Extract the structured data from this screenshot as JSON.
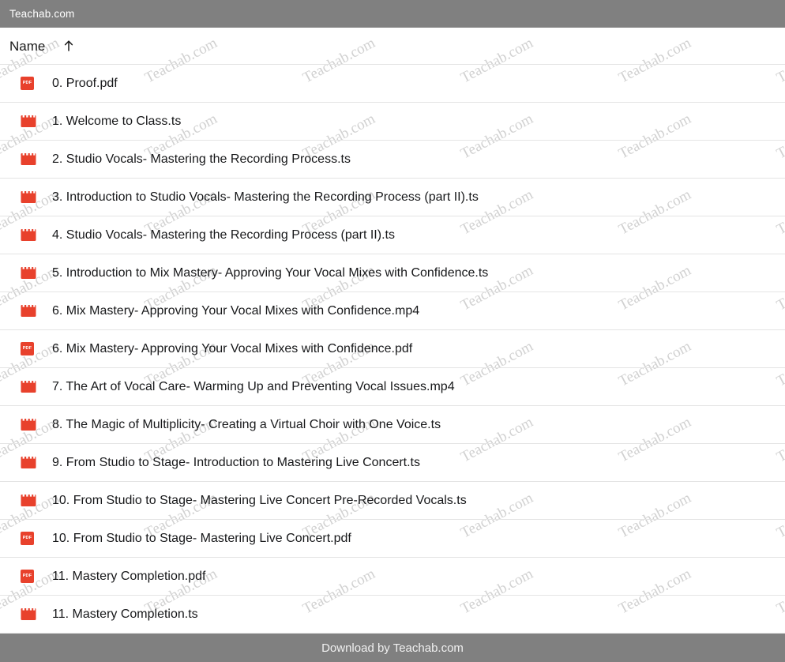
{
  "topbar": {
    "title": "Teachab.com"
  },
  "watermark": {
    "text": "Teachab.com",
    "color": "#c9c9c9"
  },
  "column_header": {
    "name_label": "Name",
    "sort_icon": "sort-ascending-arrow-icon",
    "sort_direction": "ascending"
  },
  "colors": {
    "bar_background": "#808080",
    "bar_text": "#ffffff",
    "row_text": "#17181a",
    "row_divider": "#e4e4e4",
    "pdf_icon": "#e8412c",
    "video_icon": "#e8412c"
  },
  "files": [
    {
      "icon": "pdf-file-icon",
      "type": "pdf",
      "name": "0. Proof.pdf"
    },
    {
      "icon": "video-file-icon",
      "type": "video",
      "name": "1. Welcome to Class.ts"
    },
    {
      "icon": "video-file-icon",
      "type": "video",
      "name": "2. Studio Vocals- Mastering the Recording Process.ts"
    },
    {
      "icon": "video-file-icon",
      "type": "video",
      "name": "3. Introduction to Studio Vocals- Mastering the Recording Process (part II).ts"
    },
    {
      "icon": "video-file-icon",
      "type": "video",
      "name": "4. Studio Vocals- Mastering the Recording Process (part II).ts"
    },
    {
      "icon": "video-file-icon",
      "type": "video",
      "name": "5. Introduction to Mix Mastery- Approving Your Vocal Mixes with Confidence.ts"
    },
    {
      "icon": "video-file-icon",
      "type": "video",
      "name": "6. Mix Mastery- Approving Your Vocal Mixes with Confidence.mp4"
    },
    {
      "icon": "pdf-file-icon",
      "type": "pdf",
      "name": "6. Mix Mastery- Approving Your Vocal Mixes with Confidence.pdf"
    },
    {
      "icon": "video-file-icon",
      "type": "video",
      "name": "7. The Art of Vocal Care- Warming Up and Preventing Vocal Issues.mp4"
    },
    {
      "icon": "video-file-icon",
      "type": "video",
      "name": "8. The Magic of Multiplicity- Creating a Virtual Choir with One Voice.ts"
    },
    {
      "icon": "video-file-icon",
      "type": "video",
      "name": "9. From Studio to Stage- Introduction to Mastering Live Concert.ts"
    },
    {
      "icon": "video-file-icon",
      "type": "video",
      "name": "10. From Studio to Stage- Mastering Live Concert Pre-Recorded Vocals.ts"
    },
    {
      "icon": "pdf-file-icon",
      "type": "pdf",
      "name": "10. From Studio to Stage- Mastering Live Concert.pdf"
    },
    {
      "icon": "pdf-file-icon",
      "type": "pdf",
      "name": "11. Mastery Completion.pdf"
    },
    {
      "icon": "video-file-icon",
      "type": "video",
      "name": "11. Mastery Completion.ts"
    }
  ],
  "pdf_badge_label": "PDF",
  "footer": {
    "text": "Download by Teachab.com"
  }
}
